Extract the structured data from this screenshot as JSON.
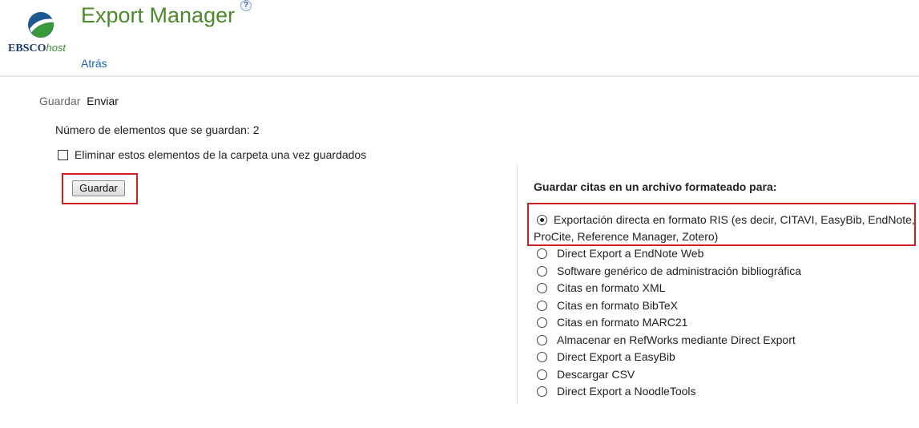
{
  "header": {
    "logo_brand": "EBSCO",
    "logo_host": "host",
    "title": "Export Manager",
    "help_glyph": "?",
    "back_label": "Atrás",
    "logo_colors": {
      "blue": "#1e3b6e",
      "green": "#3a8d3a"
    },
    "title_color": "#4b8a2c"
  },
  "tabs": [
    {
      "label": "Guardar",
      "active": false
    },
    {
      "label": "Enviar",
      "active": true
    }
  ],
  "save": {
    "count_text": "Número de elementos que se guardan: 2",
    "remove_label": "Eliminar estos elementos de la carpeta una vez guardados",
    "remove_checked": false,
    "button_label": "Guardar"
  },
  "format": {
    "heading": "Guardar citas en un archivo formateado para:",
    "options": [
      {
        "label": "Exportación directa en formato RIS (es decir, CITAVI, EasyBib, EndNote, ProCite, Reference Manager, Zotero)",
        "selected": true
      },
      {
        "label": "Direct Export a EndNote Web",
        "selected": false
      },
      {
        "label": "Software genérico de administración bibliográfica",
        "selected": false
      },
      {
        "label": "Citas en formato XML",
        "selected": false
      },
      {
        "label": "Citas en formato BibTeX",
        "selected": false
      },
      {
        "label": "Citas en formato MARC21",
        "selected": false
      },
      {
        "label": "Almacenar en RefWorks mediante Direct Export",
        "selected": false
      },
      {
        "label": "Direct Export a EasyBib",
        "selected": false
      },
      {
        "label": "Descargar CSV",
        "selected": false
      },
      {
        "label": "Direct Export a NoodleTools",
        "selected": false
      }
    ]
  },
  "highlight_color": "#d21f26"
}
